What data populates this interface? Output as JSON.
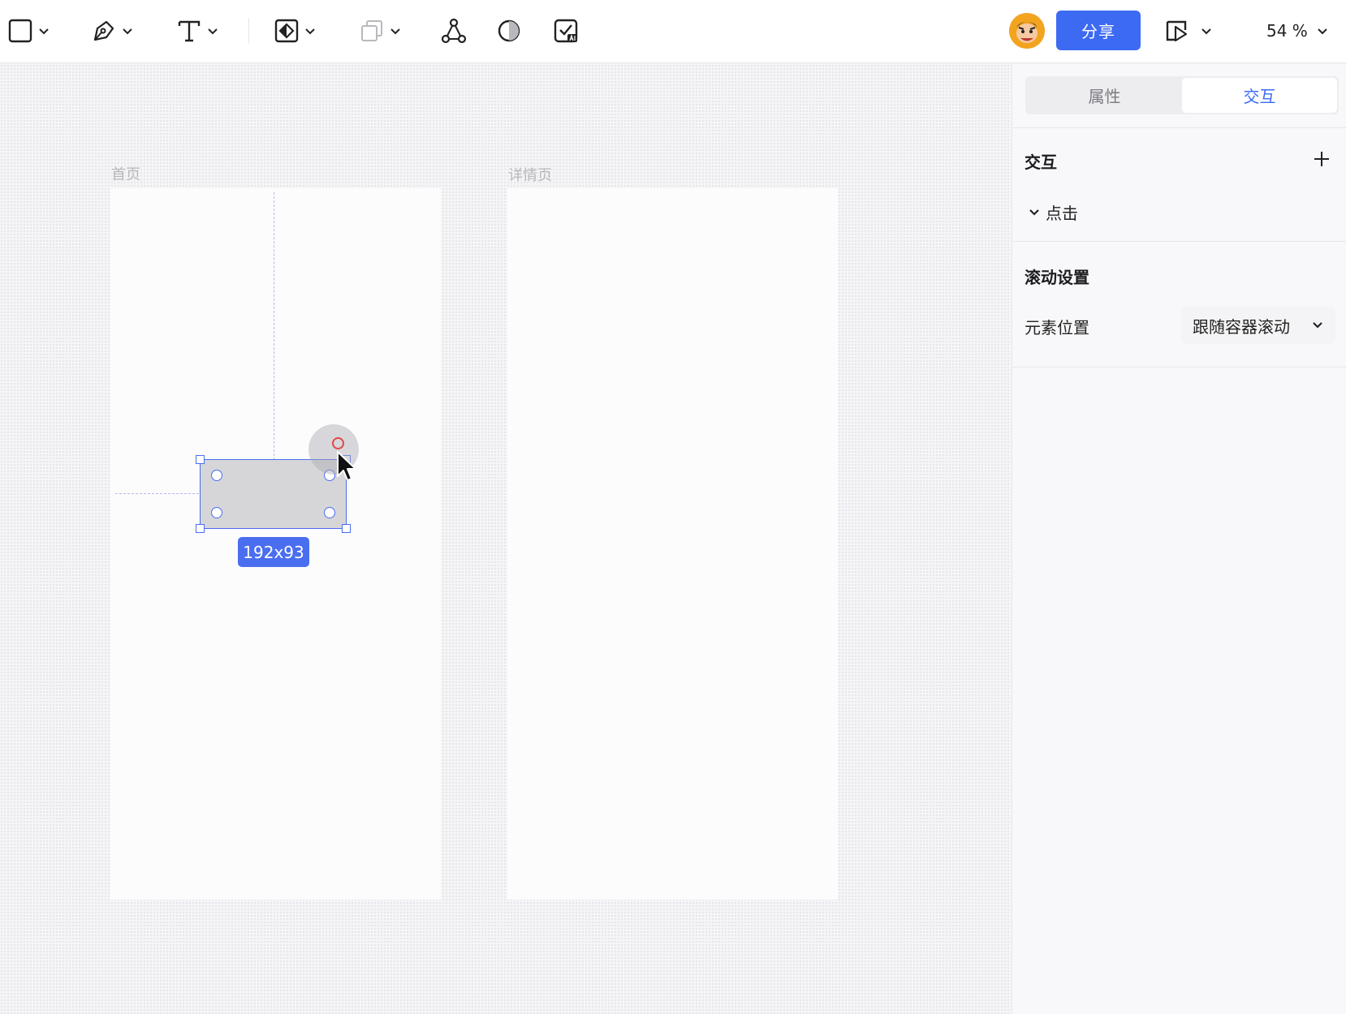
{
  "toolbar": {
    "tools": [
      {
        "name": "rectangle-tool",
        "icon": "rectangle-icon"
      },
      {
        "name": "pen-tool",
        "icon": "pen-icon"
      },
      {
        "name": "text-tool",
        "icon": "text-icon",
        "glyph": "T"
      },
      {
        "name": "component-tool",
        "icon": "component-icon"
      },
      {
        "name": "boolean-tool",
        "icon": "boolean-icon"
      },
      {
        "name": "vector-network-tool",
        "icon": "vector-nodes-icon"
      },
      {
        "name": "contrast-tool",
        "icon": "contrast-icon"
      },
      {
        "name": "ai-check-tool",
        "icon": "ai-check-icon"
      }
    ],
    "share_label": "分享",
    "zoom_label": "54 %",
    "accent_color": "#3d6af2"
  },
  "canvas": {
    "frames": [
      {
        "label": "首页"
      },
      {
        "label": "详情页"
      }
    ],
    "selection": {
      "size_label": "192x93"
    }
  },
  "panel": {
    "tabs": [
      {
        "label": "属性",
        "active": false
      },
      {
        "label": "交互",
        "active": true
      }
    ],
    "interaction": {
      "title": "交互",
      "trigger_label": "点击"
    },
    "scroll": {
      "title": "滚动设置",
      "position_label": "元素位置",
      "position_value": "跟随容器滚动"
    }
  }
}
